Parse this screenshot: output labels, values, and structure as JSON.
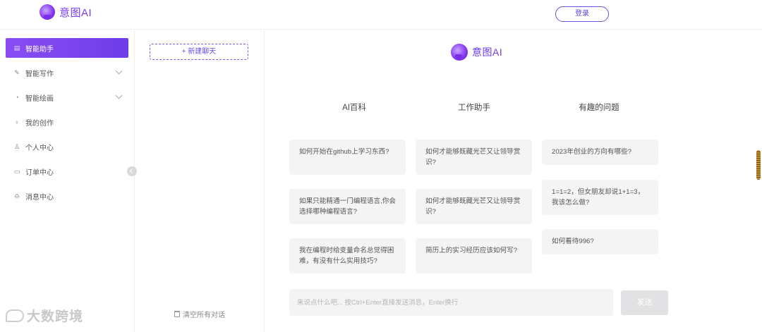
{
  "header": {
    "app_name": "意图AI",
    "login_label": "登录"
  },
  "sidebar": {
    "items": [
      {
        "label": "智能助手",
        "icon": "assistant-icon"
      },
      {
        "label": "智能写作",
        "icon": "pen-icon"
      },
      {
        "label": "智能绘画",
        "icon": "palette-icon"
      },
      {
        "label": "我的创作",
        "icon": "bulb-icon"
      },
      {
        "label": "个人中心",
        "icon": "user-icon"
      },
      {
        "label": "订单中心",
        "icon": "order-icon"
      },
      {
        "label": "消息中心",
        "icon": "bell-icon"
      }
    ],
    "watermark": "大数跨境"
  },
  "chatlist": {
    "new_chat_label": "+ 新建聊天",
    "clear_all_label": "清空所有对话"
  },
  "main": {
    "brand_name": "意图AI",
    "columns": [
      {
        "title": "AI百科",
        "cards": [
          "如何开始在github上学习东西?",
          "如果只能精通一门编程语言,你会选择哪种编程语言?",
          "我在编程时给变量命名总觉得困难，有没有什么实用技巧?"
        ]
      },
      {
        "title": "工作助手",
        "cards": [
          "如何才能够既藏光芒又让领导赏识?",
          "如何才能够既藏光芒又让领导赏识?",
          "简历上的实习经历应该如何写?"
        ]
      },
      {
        "title": "有趣的问题",
        "cards": [
          "2023年创业的方向有哪些?",
          "1=1=2，但女朋友却说1+1=3，我该怎么做?",
          "如何看待996?"
        ]
      }
    ],
    "input_placeholder": "来说点什么吧... 按Ctrl+Enter直接发送消息，Enter换行",
    "send_label": "发送"
  },
  "colors": {
    "accent": "#7a3bea",
    "active_nav_start": "#8a4df3",
    "active_nav_end": "#6d3de8"
  }
}
